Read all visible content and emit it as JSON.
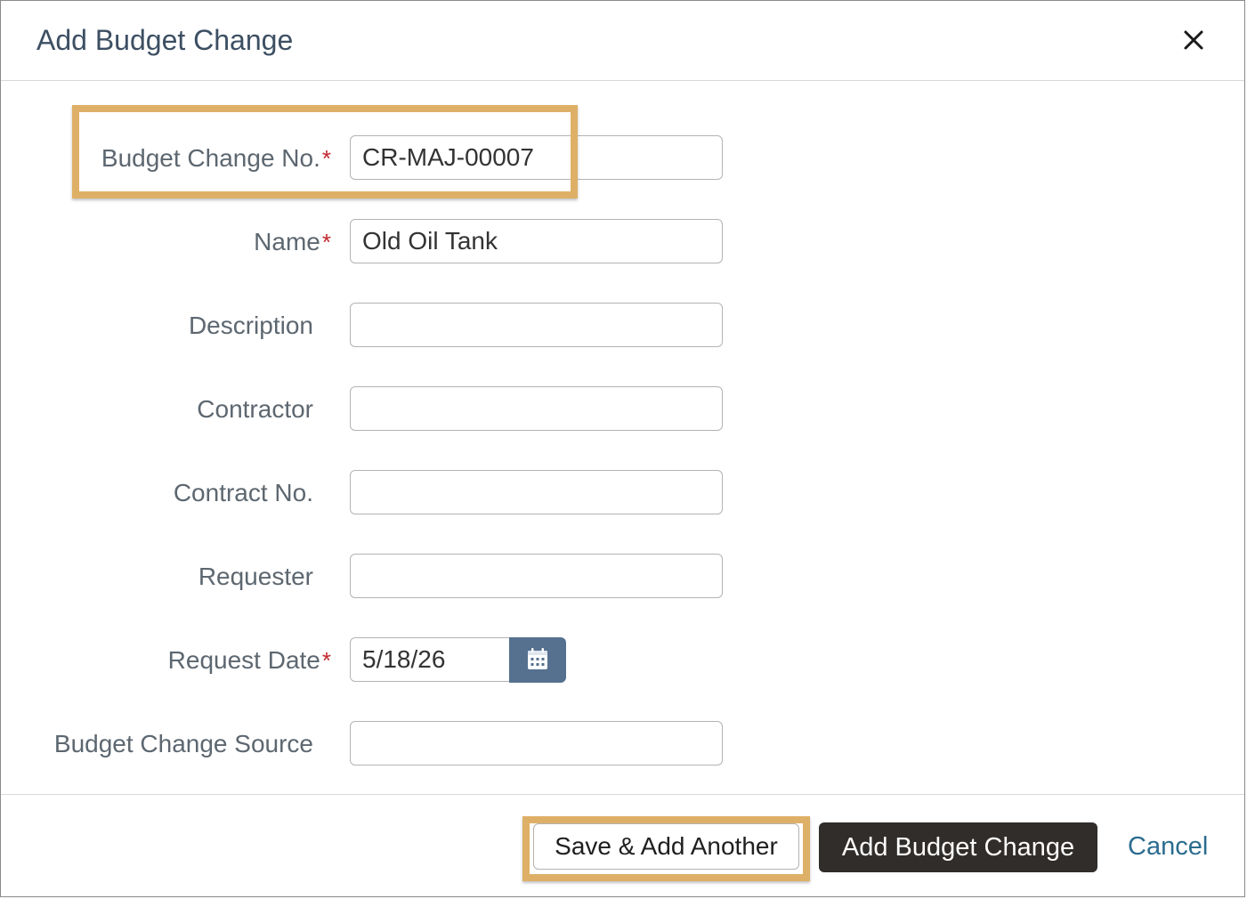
{
  "dialog": {
    "title": "Add Budget Change",
    "close_icon": "close-icon"
  },
  "fields": {
    "budget_change_no": {
      "label": "Budget Change No.",
      "required_mark": "*",
      "value": "CR-MAJ-00007"
    },
    "name": {
      "label": "Name",
      "required_mark": "*",
      "value": "Old Oil Tank"
    },
    "description": {
      "label": "Description",
      "value": ""
    },
    "contractor": {
      "label": "Contractor",
      "value": ""
    },
    "contract_no": {
      "label": "Contract No.",
      "value": ""
    },
    "requester": {
      "label": "Requester",
      "value": ""
    },
    "request_date": {
      "label": "Request Date",
      "required_mark": "*",
      "value": "5/18/26",
      "button_icon": "calendar-icon"
    },
    "budget_change_source": {
      "label": "Budget Change Source",
      "value": ""
    }
  },
  "footer": {
    "save_add_another_label": "Save & Add Another",
    "add_budget_change_label": "Add Budget Change",
    "cancel_label": "Cancel"
  },
  "colors": {
    "highlight": "#deb067",
    "primary_button": "#312d2a",
    "calendar_button": "#56708f",
    "required": "#c1272d",
    "link": "#2b6c8f"
  }
}
